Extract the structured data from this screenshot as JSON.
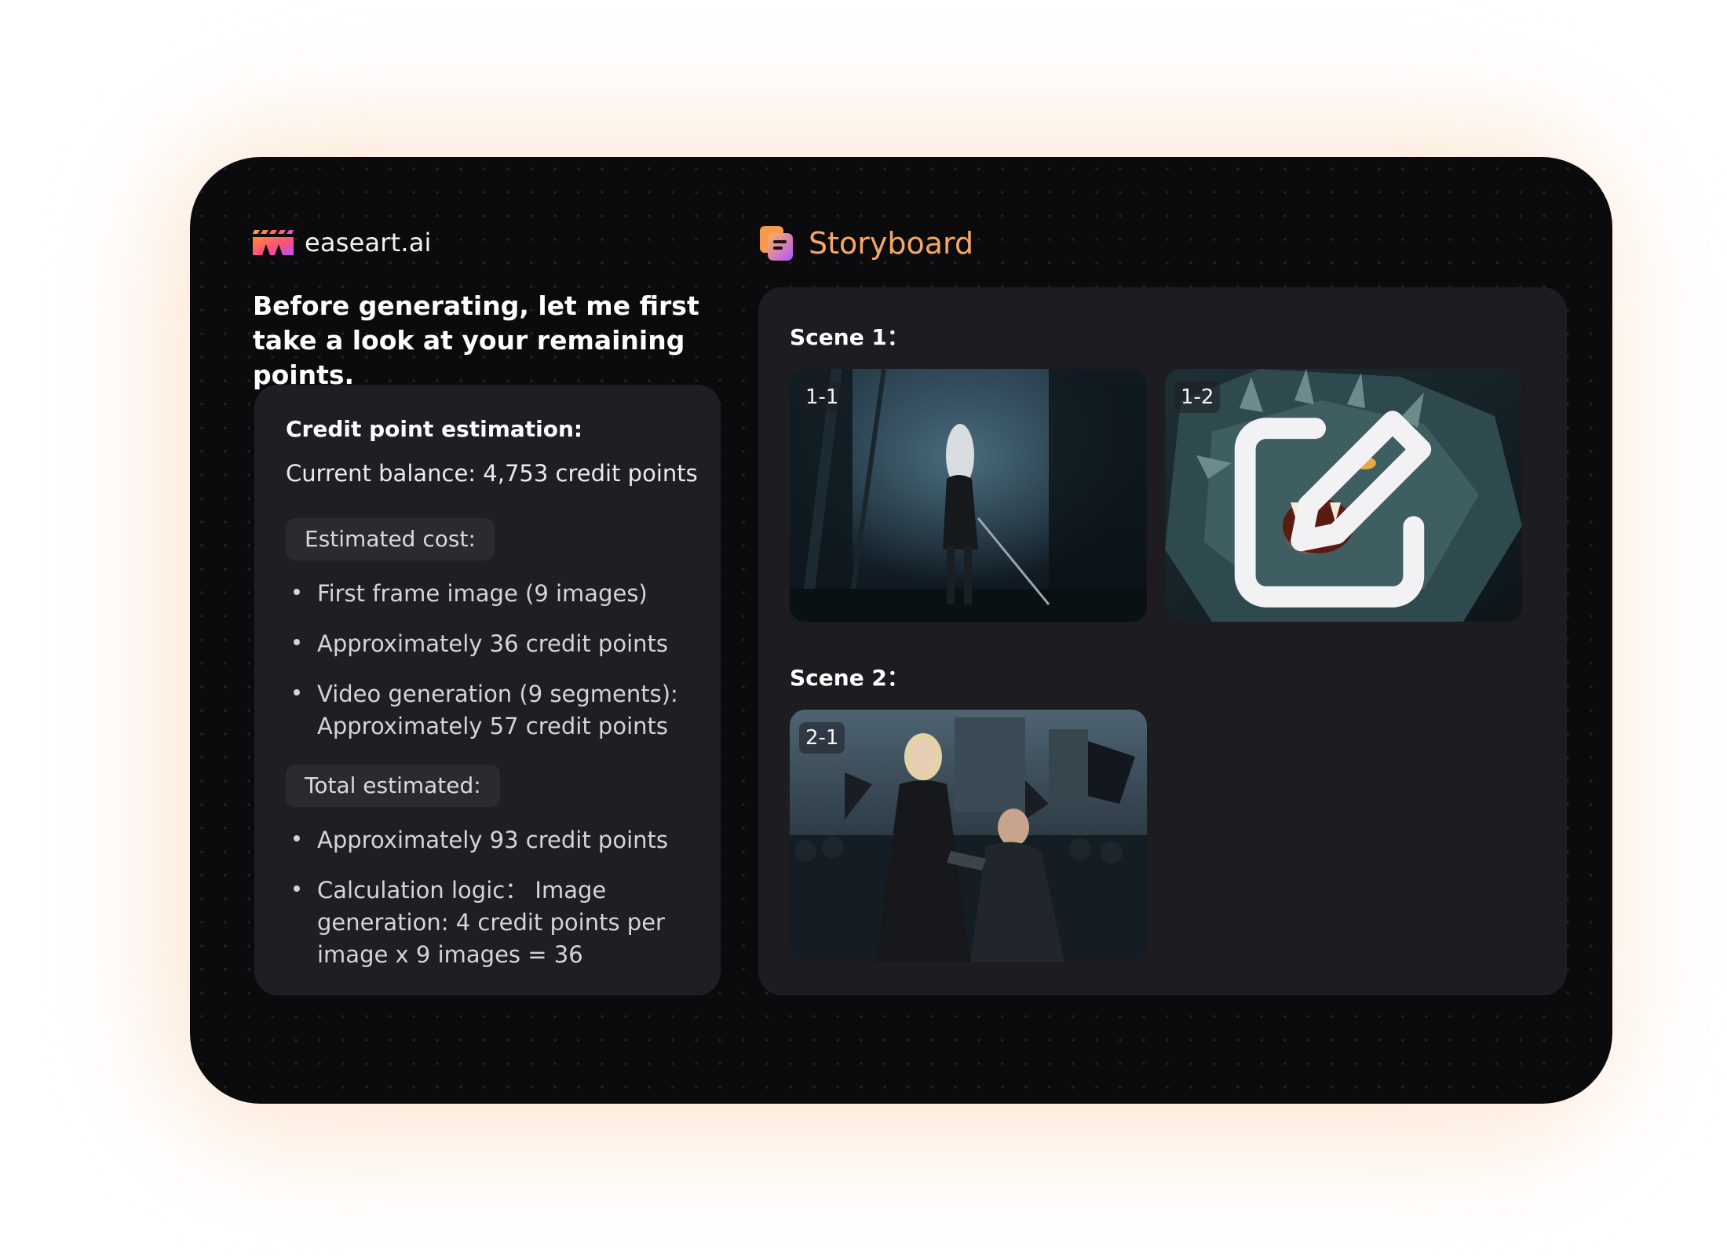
{
  "brand": {
    "name": "easeart.ai"
  },
  "intro": {
    "text": "Before generating, let me first take a look at your remaining points."
  },
  "credit": {
    "title": "Credit point estimation:",
    "balance": "Current balance: 4,753 credit points",
    "estimated_label": "Estimated cost:",
    "estimated_items": [
      "First frame image (9 images)",
      "Approximately 36 credit points",
      "Video generation (9 segments): Approximately 57 credit points"
    ],
    "total_label": "Total estimated:",
    "total_items": [
      "Approximately 93 credit points",
      "Calculation logic： Image generation: 4 credit points per image x 9 images = 36"
    ]
  },
  "storyboard": {
    "title": "Storyboard",
    "scenes": [
      {
        "label": "Scene 1：",
        "shots": [
          {
            "id": "1-1"
          },
          {
            "id": "1-2"
          }
        ]
      },
      {
        "label": "Scene 2：",
        "shots": [
          {
            "id": "2-1"
          }
        ]
      }
    ]
  },
  "colors": {
    "accent": "#f5a766",
    "background": "#0b0a0c",
    "card": "#1f1e23",
    "glow": "#fde4cf"
  },
  "icons": {
    "brand_logo": "clapperboard-logo-icon",
    "storyboard": "storyboard-icon",
    "edit": "edit-icon"
  }
}
